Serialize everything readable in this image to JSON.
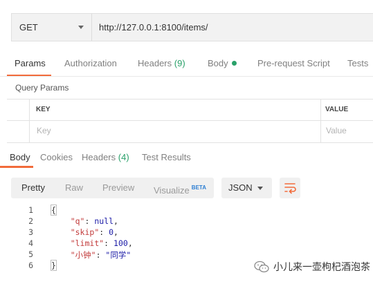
{
  "request": {
    "method": "GET",
    "url": "http://127.0.0.1:8100/items/"
  },
  "request_tabs": [
    {
      "label": "Params"
    },
    {
      "label": "Authorization"
    },
    {
      "label": "Headers",
      "count": "(9)"
    },
    {
      "label": "Body"
    },
    {
      "label": "Pre-request Script"
    },
    {
      "label": "Tests"
    }
  ],
  "query_params": {
    "title": "Query Params",
    "columns": [
      "KEY",
      "VALUE"
    ],
    "placeholders": {
      "key": "Key",
      "value": "Value"
    }
  },
  "response_tabs": [
    {
      "label": "Body"
    },
    {
      "label": "Cookies"
    },
    {
      "label": "Headers",
      "count": "(4)"
    },
    {
      "label": "Test Results"
    }
  ],
  "format": {
    "options": [
      "Pretty",
      "Raw",
      "Preview",
      "Visualize"
    ],
    "beta": "BETA",
    "language": "JSON"
  },
  "code": {
    "line_numbers": [
      "1",
      "2",
      "3",
      "4",
      "5",
      "6"
    ],
    "lines": [
      {
        "open": "{"
      },
      {
        "key": "\"q\"",
        "sep": ": ",
        "val": "null",
        "trail": ","
      },
      {
        "key": "\"skip\"",
        "sep": ": ",
        "val": "0",
        "trail": ","
      },
      {
        "key": "\"limit\"",
        "sep": ": ",
        "val": "100",
        "trail": ","
      },
      {
        "key": "\"小钟\"",
        "sep": ": ",
        "val": "\"同学\"",
        "trail": ""
      },
      {
        "close": "}"
      }
    ]
  },
  "watermark": {
    "text": "小儿来一壶枸杞酒泡茶"
  },
  "colors": {
    "accent": "#f26b3a",
    "green": "#2aa16a",
    "beta": "#2d7fd3"
  }
}
